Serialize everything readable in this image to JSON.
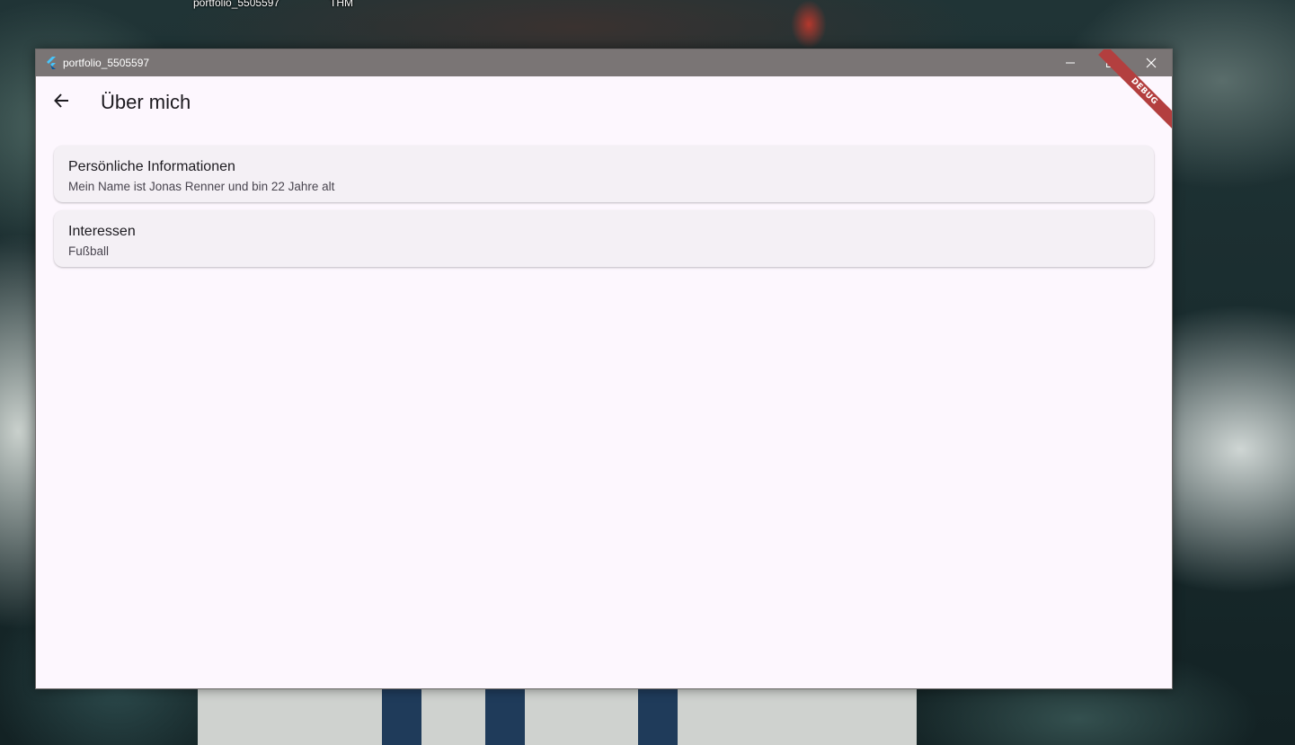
{
  "desktop": {
    "labels": [
      "portfolio_5505597",
      "THM"
    ]
  },
  "window": {
    "title": "portfolio_5505597",
    "icon": "flutter-icon",
    "controls": {
      "minimize": "minimize-icon",
      "maximize": "maximize-icon",
      "close": "close-icon"
    }
  },
  "debug_banner": "DEBUG",
  "appbar": {
    "back_icon": "arrow-back-icon",
    "title": "Über mich"
  },
  "cards": [
    {
      "title": "Persönliche Informationen",
      "subtitle": "Mein Name ist Jonas Renner und bin 22 Jahre alt"
    },
    {
      "title": "Interessen",
      "subtitle": "Fußball"
    }
  ],
  "colors": {
    "titlebar": "#7a7575",
    "background": "#fdf7fe",
    "card": "#f4f0f5",
    "debug_banner": "#b33f3f"
  }
}
